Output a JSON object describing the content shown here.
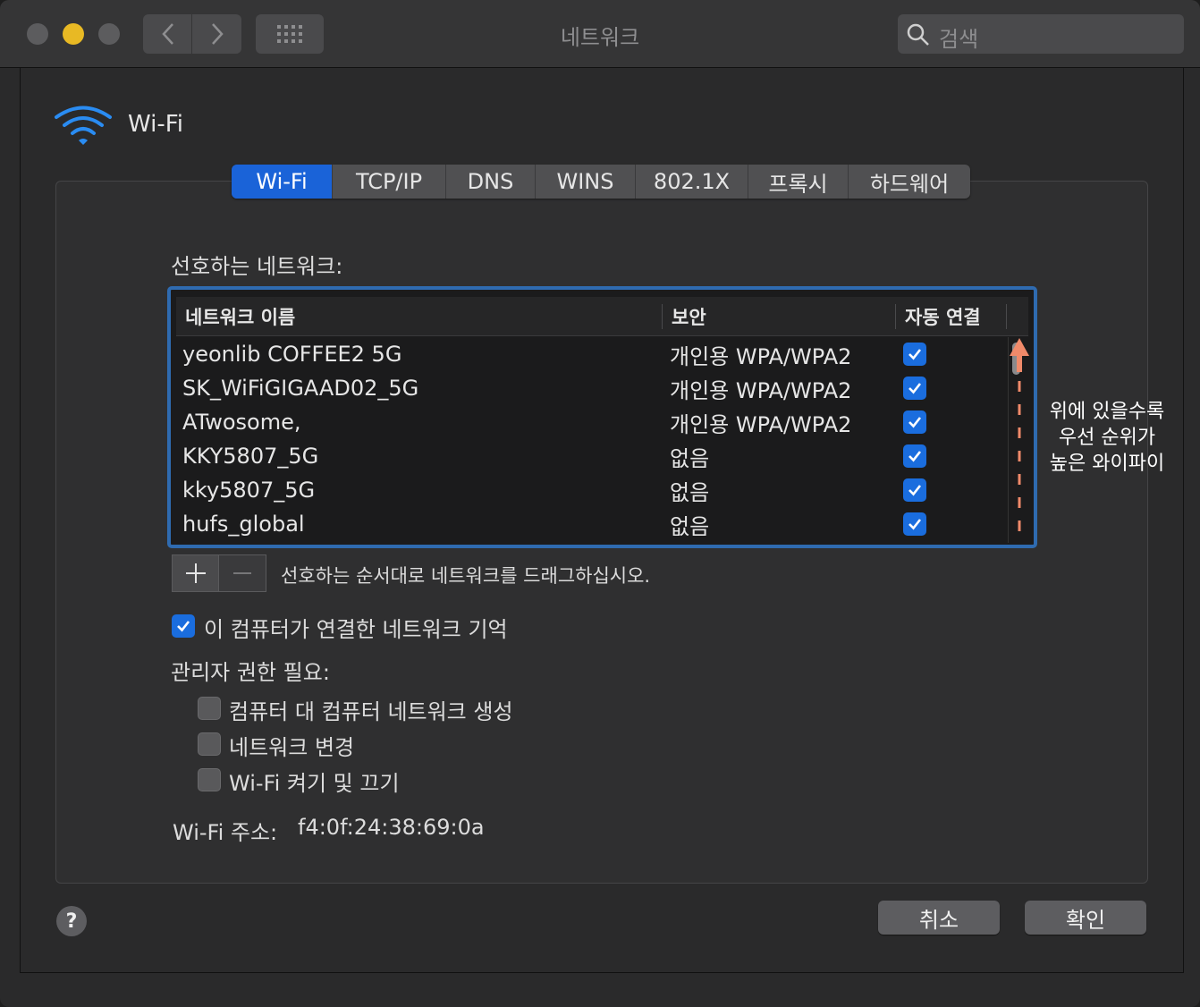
{
  "window": {
    "title": "네트워크"
  },
  "search": {
    "placeholder": "검색"
  },
  "header": {
    "label": "Wi-Fi"
  },
  "tabs": [
    {
      "label": "Wi-Fi",
      "active": true
    },
    {
      "label": "TCP/IP"
    },
    {
      "label": "DNS"
    },
    {
      "label": "WINS"
    },
    {
      "label": "802.1X"
    },
    {
      "label": "프록시"
    },
    {
      "label": "하드웨어"
    }
  ],
  "preferred": {
    "title": "선호하는 네트워크:",
    "columns": {
      "name": "네트워크 이름",
      "security": "보안",
      "auto": "자동 연결"
    },
    "rows": [
      {
        "name": "yeonlib COFFEE2 5G",
        "security": "개인용 WPA/WPA2",
        "auto": true
      },
      {
        "name": "SK_WiFiGIGAAD02_5G",
        "security": "개인용 WPA/WPA2",
        "auto": true
      },
      {
        "name": "ATwosome,",
        "security": "개인용 WPA/WPA2",
        "auto": true
      },
      {
        "name": "KKY5807_5G",
        "security": "없음",
        "auto": true
      },
      {
        "name": "kky5807_5G",
        "security": "없음",
        "auto": true
      },
      {
        "name": "hufs_global",
        "security": "없음",
        "auto": true
      }
    ],
    "drag_hint": "선호하는 순서대로 네트워크를 드래그하십시오."
  },
  "annotation": {
    "line1": "위에 있을수록",
    "line2": "우선 순위가",
    "line3": "높은 와이파이"
  },
  "remember": {
    "label": "이 컴퓨터가 연결한 네트워크 기억",
    "checked": true
  },
  "admin": {
    "title": "관리자 권한 필요:",
    "options": [
      {
        "label": "컴퓨터 대 컴퓨터 네트워크 생성",
        "checked": false
      },
      {
        "label": "네트워크 변경",
        "checked": false
      },
      {
        "label": "Wi-Fi 켜기 및 끄기",
        "checked": false
      }
    ]
  },
  "address": {
    "label": "Wi-Fi 주소:",
    "value": "f4:0f:24:38:69:0a"
  },
  "buttons": {
    "cancel": "취소",
    "ok": "확인",
    "help": "?"
  },
  "colors": {
    "accent": "#1a63d8",
    "highlight_border": "#2f6bb0",
    "annotation_arrow": "#f08a6a"
  }
}
